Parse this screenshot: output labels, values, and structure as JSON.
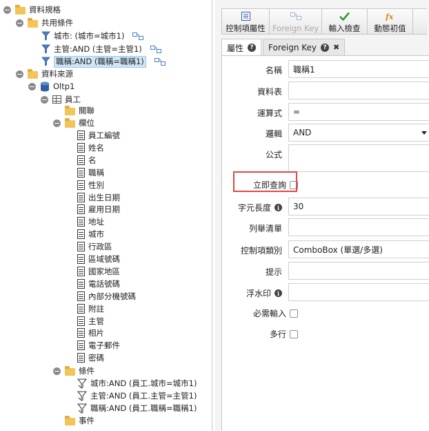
{
  "tree": {
    "root": "資料規格",
    "shared_conditions": {
      "label": "共用條件",
      "items": [
        "城市: (城市=城市1)",
        "主管:AND (主管=主管1)",
        "職稱:AND (職稱=職稱1)"
      ]
    },
    "data_source": {
      "label": "資料來源",
      "db": "Oltp1",
      "table": "員工",
      "relation_folder": "關聯",
      "fields_folder": "欄位",
      "fields": [
        "員工編號",
        "姓名",
        "名",
        "職稱",
        "性別",
        "出生日期",
        "雇用日期",
        "地址",
        "城市",
        "行政區",
        "區域號碼",
        "國家地區",
        "電話號碼",
        "內部分機號碼",
        "附註",
        "主管",
        "相片",
        "電子郵件",
        "密碼"
      ],
      "conditions_folder": "條件",
      "conditions": [
        "城市:AND (員工.城市=城市1)",
        "主管:AND (員工.主管=主管1)",
        "職稱:AND (員工.職稱=職稱1)"
      ],
      "events_folder": "事件"
    }
  },
  "toolbar": {
    "buttons": [
      "控制項屬性",
      "Foreign Key",
      "輸入檢查",
      "動態初值"
    ]
  },
  "tabs": [
    "屬性",
    "Foreign Key"
  ],
  "form": {
    "name_label": "名稱",
    "name_value": "職稱1",
    "table_label": "資料表",
    "table_value": "",
    "operator_label": "運算式",
    "operator_value": "=",
    "logic_label": "邏輯",
    "logic_value": "AND",
    "formula_label": "公式",
    "formula_value": "",
    "instant_query_label": "立即查詢",
    "char_length_label": "字元長度",
    "char_length_value": "30",
    "list_label": "列舉清單",
    "list_value": "",
    "control_type_label": "控制項類別",
    "control_type_value": "ComboBox (單選/多選)",
    "hint_label": "提示",
    "hint_value": "",
    "watermark_label": "浮水印",
    "watermark_value": "",
    "required_label": "必需輸入",
    "multiline_label": "多行"
  },
  "colors": {
    "highlight": "#e04545",
    "selected": "#cfe6f7",
    "folder": "#f2c55a"
  }
}
